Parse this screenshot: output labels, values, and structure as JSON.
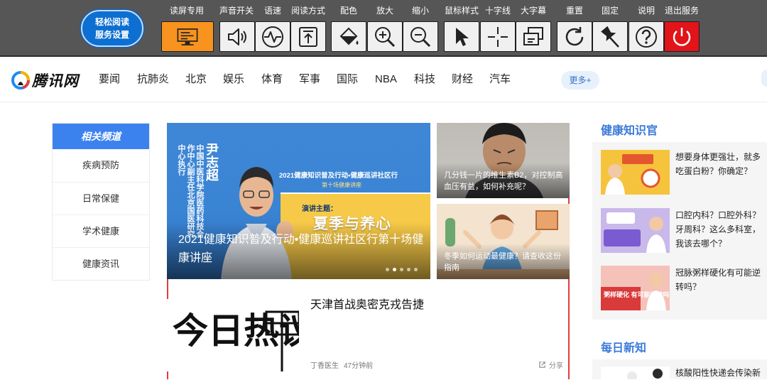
{
  "toolbar": {
    "logo_line1": "轻松阅读",
    "logo_line2": "服务设置",
    "tools": [
      {
        "label": "读屏专用",
        "icon": "screen-reader-icon"
      },
      {
        "label": "声音开关",
        "icon": "speaker-icon"
      },
      {
        "label": "语速",
        "icon": "speech-rate-icon"
      },
      {
        "label": "阅读方式",
        "icon": "reading-mode-icon"
      },
      {
        "label": "配色",
        "icon": "color-scheme-icon"
      },
      {
        "label": "放大",
        "icon": "zoom-in-icon"
      },
      {
        "label": "缩小",
        "icon": "zoom-out-icon"
      },
      {
        "label": "鼠标样式",
        "icon": "cursor-icon"
      },
      {
        "label": "十字线",
        "icon": "crosshair-icon"
      },
      {
        "label": "大字幕",
        "icon": "caption-icon"
      },
      {
        "label": "重置",
        "icon": "reset-icon"
      },
      {
        "label": "固定",
        "icon": "pin-icon"
      },
      {
        "label": "说明",
        "icon": "help-icon"
      },
      {
        "label": "退出服务",
        "icon": "power-icon"
      }
    ],
    "colors": {
      "bar": "#565656",
      "active": "#f7931e",
      "exit": "#e1141a"
    }
  },
  "nav": {
    "brand": "腾讯网",
    "items": [
      "要闻",
      "抗肺炎",
      "北京",
      "娱乐",
      "体育",
      "军事",
      "国际",
      "NBA",
      "科技",
      "财经",
      "汽车"
    ],
    "more": "更多+"
  },
  "channels": {
    "title": "相关频道",
    "items": [
      "疾病预防",
      "日常保健",
      "学术健康",
      "健康资讯"
    ]
  },
  "hero": {
    "image_text": {
      "vertical": "中国中医科学院医药科技合作中心副主任北京国医研究中心执行",
      "name": "尹志超",
      "event": "2021健康知识普及行动•健康巡讲社区行",
      "event_sub": "第十场健康讲座",
      "topic_label": "演讲主题：",
      "topic": "夏季与养心"
    },
    "caption": "2021健康知识普及行动•健康巡讲社区行第十场健康讲座",
    "slides": 5,
    "active_slide": 2
  },
  "side_cards": [
    {
      "caption": "几分钱一片的维生素B2，对控制高血压有益，如何补充呢？"
    },
    {
      "caption": "冬季如何运动最健康？请查收这份指南"
    }
  ],
  "article": {
    "thumb_text": "今日热议",
    "title": "天津首战奥密克戎告捷",
    "source": "丁香医生",
    "time": "47分钟前",
    "share": "分享"
  },
  "right": {
    "section1_title": "健康知识官",
    "section1_items": [
      {
        "text": "想要身体更强壮，就多吃蛋白粉？你确定？"
      },
      {
        "text": "口腔内科？口腔外科？牙周科？这么多科室，我该去哪个？"
      },
      {
        "text": "冠脉粥样硬化有可能逆转吗？",
        "thumb_text": "粥样硬化 有可能逆转吗？"
      }
    ],
    "section2_title": "每日新知",
    "section2_items": [
      {
        "text": "核酸阳性快递会传染新"
      }
    ]
  }
}
